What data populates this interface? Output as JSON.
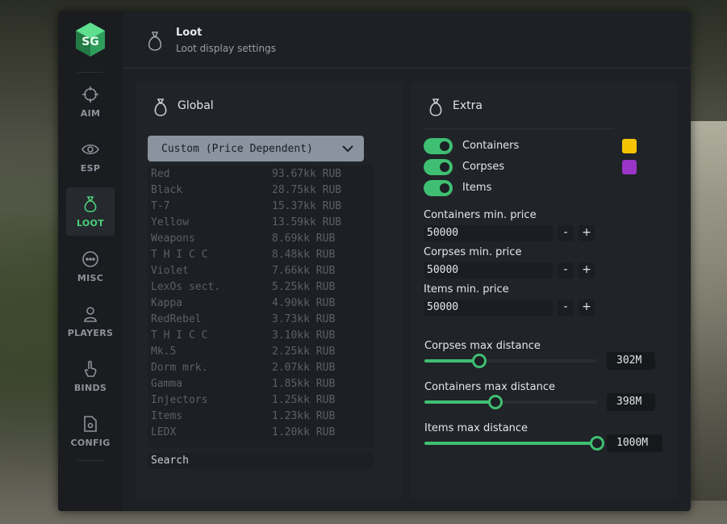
{
  "sidebar": {
    "items": [
      {
        "label": "AIM",
        "icon": "crosshair-icon"
      },
      {
        "label": "ESP",
        "icon": "eye-icon"
      },
      {
        "label": "LOOT",
        "icon": "loot-bag-icon"
      },
      {
        "label": "MISC",
        "icon": "dots-icon"
      },
      {
        "label": "PLAYERS",
        "icon": "user-icon"
      },
      {
        "label": "BINDS",
        "icon": "pointer-hand-icon"
      },
      {
        "label": "CONFIG",
        "icon": "config-file-icon"
      }
    ],
    "active": "LOOT",
    "accent": "#4ad07a"
  },
  "header": {
    "title": "Loot",
    "subtitle": "Loot display settings",
    "icon": "loot-bag-icon"
  },
  "global": {
    "title": "Global",
    "dropdown_value": "Custom (Price Dependent)",
    "items": [
      {
        "name": "Red",
        "price": "93.67kk RUB"
      },
      {
        "name": "Black",
        "price": "28.75kk RUB"
      },
      {
        "name": "T-7",
        "price": "15.37kk RUB"
      },
      {
        "name": "Yellow",
        "price": "13.59kk RUB"
      },
      {
        "name": "Weapons",
        "price": "8.69kk RUB"
      },
      {
        "name": "T H I C C",
        "price": "8.48kk RUB"
      },
      {
        "name": "Violet",
        "price": "7.66kk RUB"
      },
      {
        "name": "LexOs sect.",
        "price": "5.25kk RUB"
      },
      {
        "name": "Kappa",
        "price": "4.90kk RUB"
      },
      {
        "name": "RedRebel",
        "price": "3.73kk RUB"
      },
      {
        "name": "T H I C C",
        "price": "3.10kk RUB"
      },
      {
        "name": "Mk.5",
        "price": "2.25kk RUB"
      },
      {
        "name": "Dorm mrk.",
        "price": "2.07kk RUB"
      },
      {
        "name": "Gamma",
        "price": "1.85kk RUB"
      },
      {
        "name": "Injectors",
        "price": "1.25kk RUB"
      },
      {
        "name": "Items",
        "price": "1.23kk RUB"
      },
      {
        "name": "LEDX",
        "price": "1.20kk RUB"
      }
    ],
    "search_placeholder": "Search"
  },
  "extra": {
    "title": "Extra",
    "toggles": [
      {
        "label": "Containers",
        "on": true,
        "color": "#f5c400"
      },
      {
        "label": "Corpses",
        "on": true,
        "color": "#9a35c8"
      },
      {
        "label": "Items",
        "on": true,
        "color": null
      }
    ],
    "prices": [
      {
        "label": "Containers min. price",
        "value": "50000",
        "minus": "-",
        "plus": "+"
      },
      {
        "label": "Corpses min. price",
        "value": "50000",
        "minus": "-",
        "plus": "+"
      },
      {
        "label": "Items min. price",
        "value": "50000",
        "minus": "-",
        "plus": "+"
      }
    ],
    "sliders": [
      {
        "label": "Corpses max distance",
        "value": "302M",
        "fraction": 0.32
      },
      {
        "label": "Containers max distance",
        "value": "398M",
        "fraction": 0.41
      },
      {
        "label": "Items max distance",
        "value": "1000M",
        "fraction": 1.0
      }
    ]
  }
}
